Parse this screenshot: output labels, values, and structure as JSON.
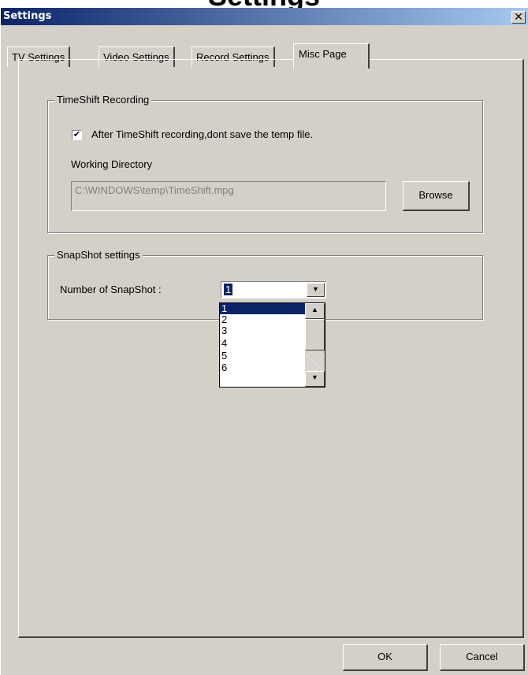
{
  "background_heading": "Settings",
  "window": {
    "title": "Settings",
    "close_glyph": "✕"
  },
  "tabs": [
    {
      "label": "TV Settings",
      "active": false
    },
    {
      "label": "Video Settings",
      "active": false
    },
    {
      "label": "Record Settings",
      "active": false
    },
    {
      "label": "Misc Page",
      "active": true
    }
  ],
  "timeshift": {
    "legend": "TimeShift Recording",
    "checkbox_checked": true,
    "checkbox_mark": "✔",
    "checkbox_label": "After TimeShift recording,dont save the temp file.",
    "working_dir_label": "Working Directory",
    "working_dir_value": "C:\\WINDOWS\\temp\\TimeShift.mpg",
    "browse_label": "Browse"
  },
  "snapshot": {
    "legend": "SnapShot settings",
    "count_label": "Number of SnapShot :",
    "selected_value": "1",
    "options": [
      "1",
      "2",
      "3",
      "4",
      "5",
      "6"
    ]
  },
  "icons": {
    "dropdown_arrow": "▼",
    "scroll_up": "▲",
    "scroll_down": "▼"
  },
  "footer": {
    "ok_label": "OK",
    "cancel_label": "Cancel"
  },
  "colors": {
    "window_bg": "#d4d0c8",
    "titlebar_start": "#0a246a",
    "titlebar_end": "#a6caf0",
    "selection": "#0a246a"
  }
}
